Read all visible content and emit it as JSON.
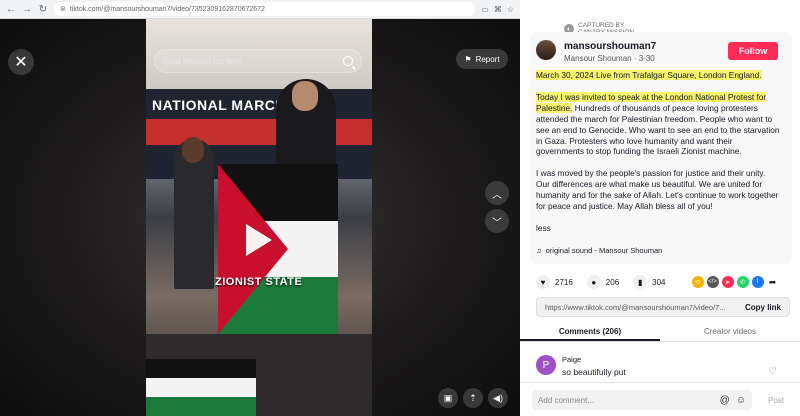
{
  "browser": {
    "url": "tiktok.com/@mansourshouman7/video/7352309162870672672"
  },
  "video": {
    "search_placeholder": "Find related content",
    "report_label": "Report",
    "banner_text": "NATIONAL MARCH FO",
    "caption_overlay": "ZIONIST STATE"
  },
  "watermark": {
    "line1": "CAPTURED BY",
    "line2": "CANARY MISSION"
  },
  "post": {
    "username": "mansourshouman7",
    "display_name": "Mansour Shouman",
    "date": "3-30",
    "follow_label": "Follow",
    "highlight1": "March 30, 2024 Live from Trafalgar Square, London England.",
    "highlight2": "Today I was invited to speak at the London National Protest for Palestine.",
    "para2_rest": " Hundreds of thousands of peace loving protesters attended the march for Palestinian freedom. People who want to see an end to Genocide. Who want to see an end to the starvation in Gaza. Protesters who love humanity and want their governments to stop funding the Israeli Zionist machine.",
    "para3": "I was moved by the people's passion for justice and their unity. Our differences are what make us beautiful. We are united for humanity and for the sake of Allah. Let's continue to work together for peace and justice. May Allah bless all of you!",
    "less_label": "less",
    "sound": "original sound - Mansour Shouman"
  },
  "actions": {
    "likes": "2716",
    "comments": "206",
    "saves": "304"
  },
  "share": {
    "link": "https://www.tiktok.com/@mansourshouman7/video/7...",
    "copy_label": "Copy link"
  },
  "tabs": {
    "comments": "Comments (206)",
    "creator": "Creator videos"
  },
  "comment": {
    "initial": "P",
    "name": "Paige",
    "text": "so beautifully put"
  },
  "comment_box": {
    "placeholder": "Add comment...",
    "post_label": "Post"
  },
  "colors": {
    "follow": "#fe2c55",
    "highlight": "#f7f36d"
  }
}
